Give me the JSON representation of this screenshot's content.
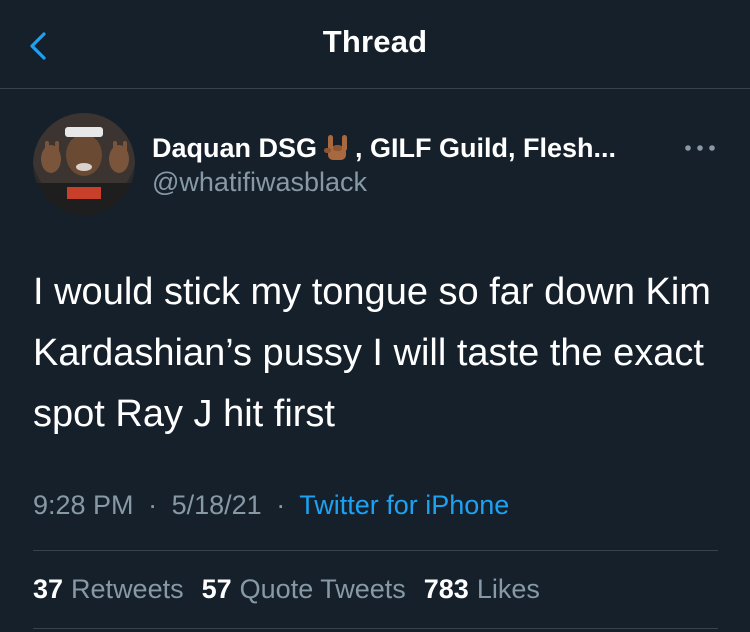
{
  "header": {
    "title": "Thread",
    "back_icon": "chevron-left-icon"
  },
  "colors": {
    "background": "#15202b",
    "accent": "#1da1f2",
    "muted": "#8899a6",
    "divider": "#38444d"
  },
  "tweet": {
    "author": {
      "name_start": "Daquan DSG",
      "name_emoji": "sign-of-the-horns-emoji",
      "name_rest": ", GILF Guild, Flesh...",
      "handle": "@whatifiwasblack"
    },
    "text": "I would stick my tongue so far down Kim Kardashian’s pussy I will taste the exact spot Ray J hit first",
    "time": "9:28 PM",
    "date": "5/18/21",
    "separator": "·",
    "source": "Twitter for iPhone",
    "stats": [
      {
        "count": "37",
        "label": "Retweets"
      },
      {
        "count": "57",
        "label": "Quote Tweets"
      },
      {
        "count": "783",
        "label": "Likes"
      }
    ]
  }
}
